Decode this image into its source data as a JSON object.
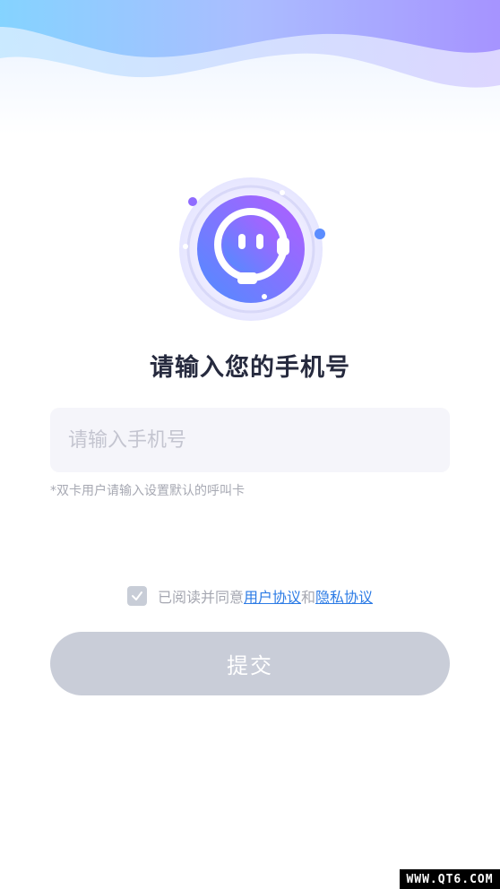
{
  "page": {
    "title": "请输入您的手机号",
    "phone_input": {
      "placeholder": "请输入手机号",
      "value": ""
    },
    "hint": "*双卡用户请输入设置默认的呼叫卡",
    "agreement": {
      "checked": true,
      "prefix": "已阅读并同意",
      "user_agreement": "用户协议",
      "joiner": "和",
      "privacy_agreement": "隐私协议"
    },
    "submit_label": "提交"
  },
  "watermark": "WWW.QT6.COM",
  "colors": {
    "title": "#262a3e",
    "input_bg": "#f5f5fa",
    "button_disabled": "#c9cdd8",
    "link": "#2c7be5",
    "logo_gradient_start": "#6c7cff",
    "logo_gradient_end": "#b35cff"
  },
  "icons": {
    "logo": "customer-service-robot-icon",
    "checkbox": "check-icon"
  }
}
